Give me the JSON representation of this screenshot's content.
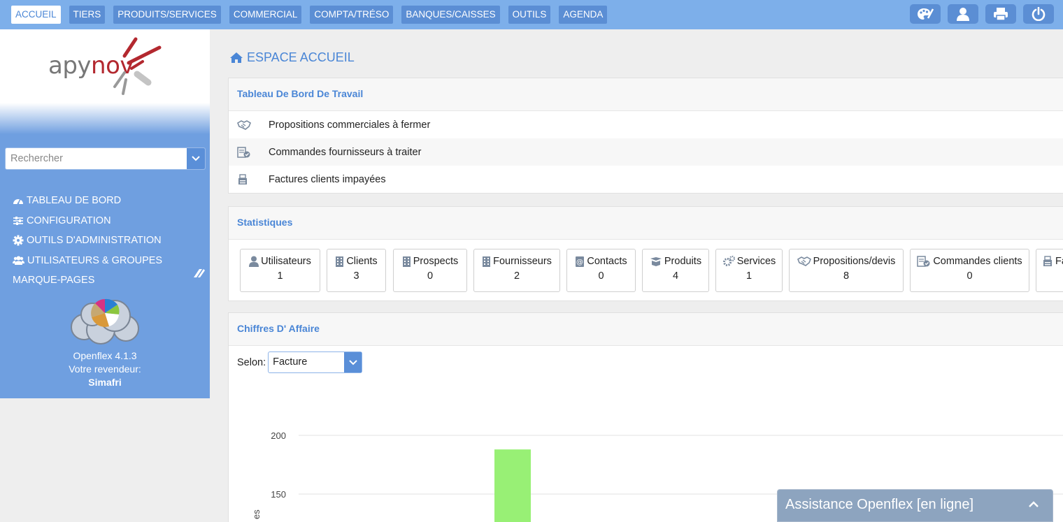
{
  "topnav": {
    "tabs": [
      {
        "label": "ACCUEIL"
      },
      {
        "label": "TIERS"
      },
      {
        "label": "PRODUITS/SERVICES"
      },
      {
        "label": "COMMERCIAL"
      },
      {
        "label": "COMPTA/TRÉSO"
      },
      {
        "label": "BANQUES/CAISSES"
      },
      {
        "label": "OUTILS"
      },
      {
        "label": "AGENDA"
      }
    ],
    "icons": [
      "palette-icon",
      "user-icon",
      "printer-icon",
      "power-icon"
    ]
  },
  "sidebar": {
    "logo": {
      "part1": "apy",
      "part2": "nov"
    },
    "search_placeholder": "Rechercher",
    "menu": [
      {
        "label": "TABLEAU DE BORD",
        "icon": "dashboard-icon"
      },
      {
        "label": "CONFIGURATION",
        "icon": "sliders-icon"
      },
      {
        "label": "OUTILS D'ADMINISTRATION",
        "icon": "gear-icon"
      },
      {
        "label": "UTILISATEURS & GROUPES",
        "icon": "users-icon"
      },
      {
        "label": "MARQUE-PAGES",
        "icon": "bookmark-icon"
      }
    ],
    "version": "Openflex 4.1.3",
    "reseller_label": "Votre revendeur:",
    "reseller": "Simafri"
  },
  "main": {
    "title": "ESPACE ACCUEIL",
    "workboard": {
      "title": "Tableau De Bord De Travail",
      "rows": [
        {
          "label": "Propositions commerciales à fermer",
          "icon": "handshake-icon"
        },
        {
          "label": "Commandes fournisseurs à traiter",
          "icon": "order-check-icon"
        },
        {
          "label": "Factures clients impayées",
          "icon": "invoice-printer-icon"
        }
      ]
    },
    "stats": {
      "title": "Statistiques",
      "items": [
        {
          "label": "Utilisateurs",
          "value": "1",
          "icon": "user-icon"
        },
        {
          "label": "Clients",
          "value": "3",
          "icon": "building-icon"
        },
        {
          "label": "Prospects",
          "value": "0",
          "icon": "building-icon"
        },
        {
          "label": "Fournisseurs",
          "value": "2",
          "icon": "building-icon"
        },
        {
          "label": "Contacts",
          "value": "0",
          "icon": "address-book-icon"
        },
        {
          "label": "Produits",
          "value": "4",
          "icon": "box-icon"
        },
        {
          "label": "Services",
          "value": "1",
          "icon": "gears-icon"
        },
        {
          "label": "Propositions/devis",
          "value": "8",
          "icon": "handshake-icon"
        },
        {
          "label": "Commandes clients",
          "value": "0",
          "icon": "order-check-icon"
        },
        {
          "label": "Fa",
          "value": "",
          "icon": "invoice-printer-icon"
        }
      ]
    },
    "revenue": {
      "title": "Chiffres D' Affaire",
      "selon_label": "Selon:",
      "selon_value": "Facture"
    }
  },
  "chart_data": {
    "type": "bar",
    "ylabel_fragment": "es",
    "yticks": [
      150,
      200
    ],
    "values": [
      188
    ],
    "bar_color": "#98f075"
  },
  "chat": {
    "title": "Assistance Openflex [en ligne]"
  },
  "colors": {
    "topbar": "#7dafea",
    "nav_tab": "#5b8ed4",
    "sidebar": "#6f9fe0",
    "accent": "#4a86d6"
  }
}
